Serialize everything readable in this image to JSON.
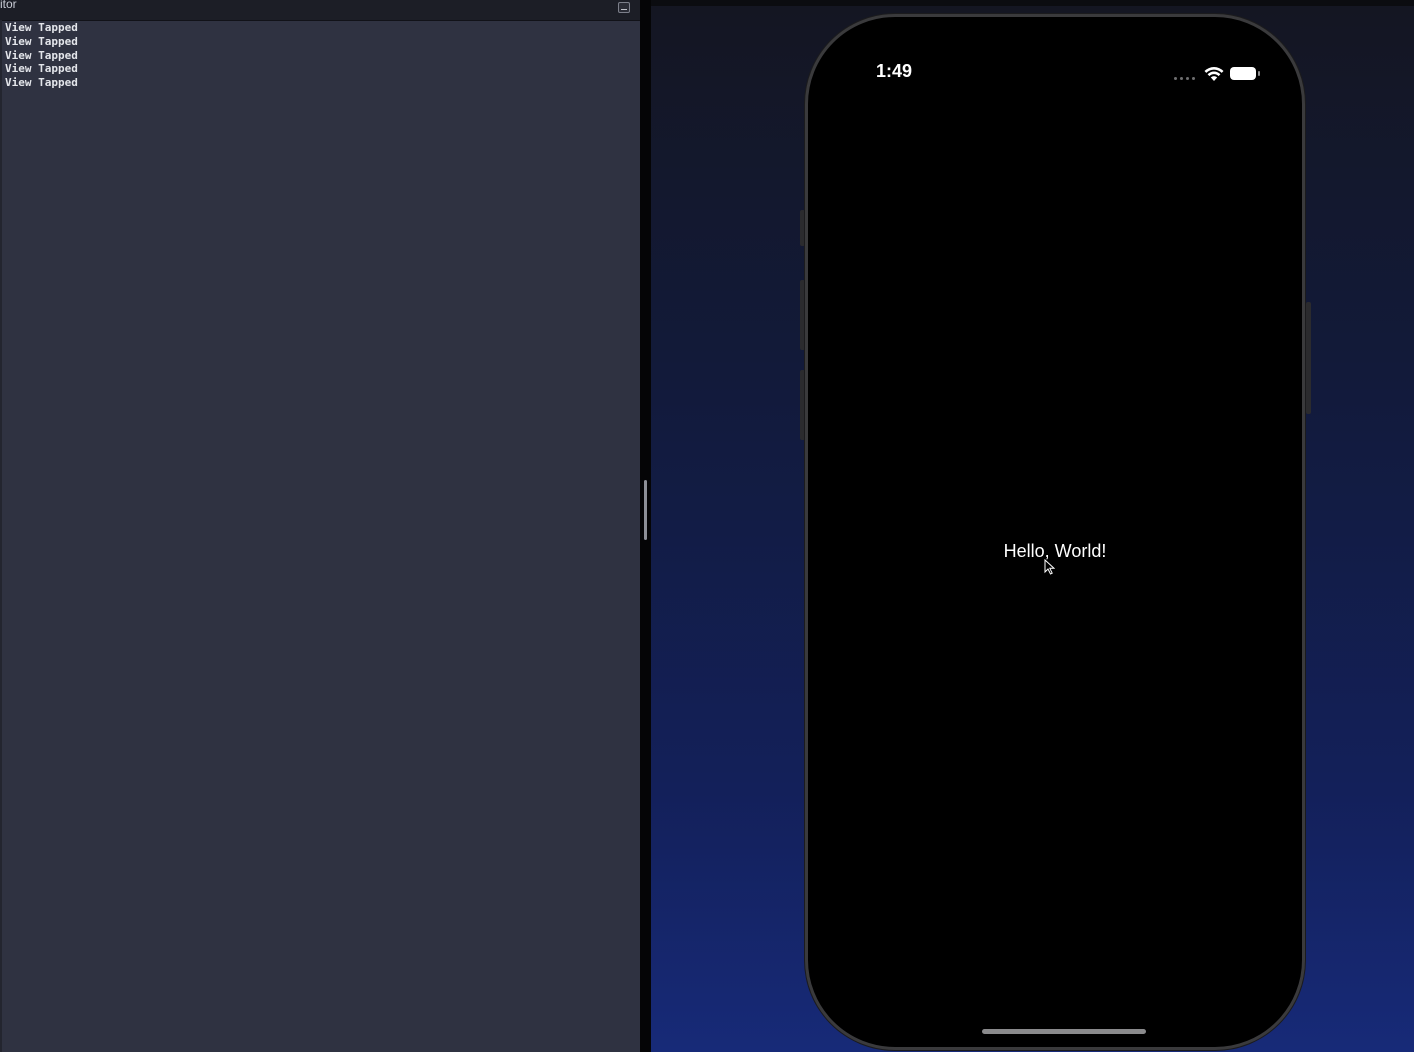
{
  "console": {
    "title": "itor",
    "lines": [
      "View Tapped",
      "View Tapped",
      "View Tapped",
      "View Tapped",
      "View Tapped"
    ]
  },
  "simulator": {
    "status_time": "1:49",
    "content_text": "Hello, World!"
  },
  "icons": {
    "console_minimize": "minimize-icon",
    "wifi": "wifi-icon",
    "battery": "battery-icon",
    "signal": "signal-icon",
    "cursor": "pointer-cursor-icon"
  },
  "colors": {
    "console_background": "#2f3241",
    "console_text": "#e3e5ea",
    "simulator_gradient_bottom": "#172a78",
    "screen_background": "#000000"
  }
}
